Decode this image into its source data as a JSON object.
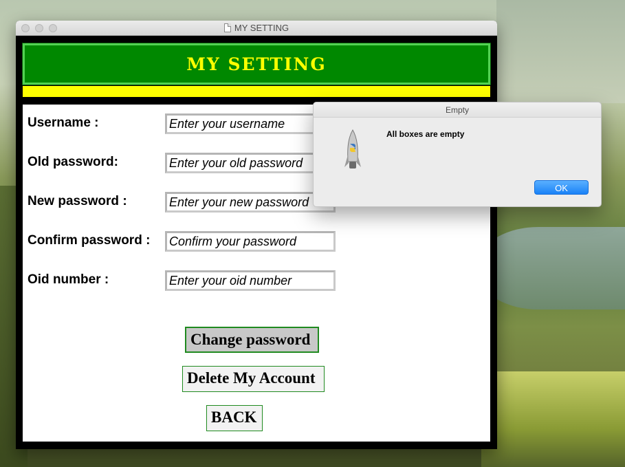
{
  "window": {
    "title": "MY SETTING"
  },
  "header": {
    "title": "MY SETTING"
  },
  "form": {
    "fields": [
      {
        "label": "Username :",
        "placeholder": "Enter your username"
      },
      {
        "label": "Old password:",
        "placeholder": "Enter your old password"
      },
      {
        "label": "New password :",
        "placeholder": "Enter your new password"
      },
      {
        "label": "Confirm password :",
        "placeholder": "Confirm your password"
      },
      {
        "label": "Oid number :",
        "placeholder": "Enter your oid number"
      }
    ]
  },
  "buttons": {
    "change_password": "Change password",
    "delete_account": "Delete My Account",
    "back": "BACK"
  },
  "dialog": {
    "title": "Empty",
    "message": "All boxes are empty",
    "ok_label": "OK"
  },
  "colors": {
    "header_bg": "#008800",
    "header_text": "#ffff00",
    "accent_bar": "#ffff00",
    "button_border": "#1f8a1f",
    "ok_button": "#1a82f7"
  }
}
